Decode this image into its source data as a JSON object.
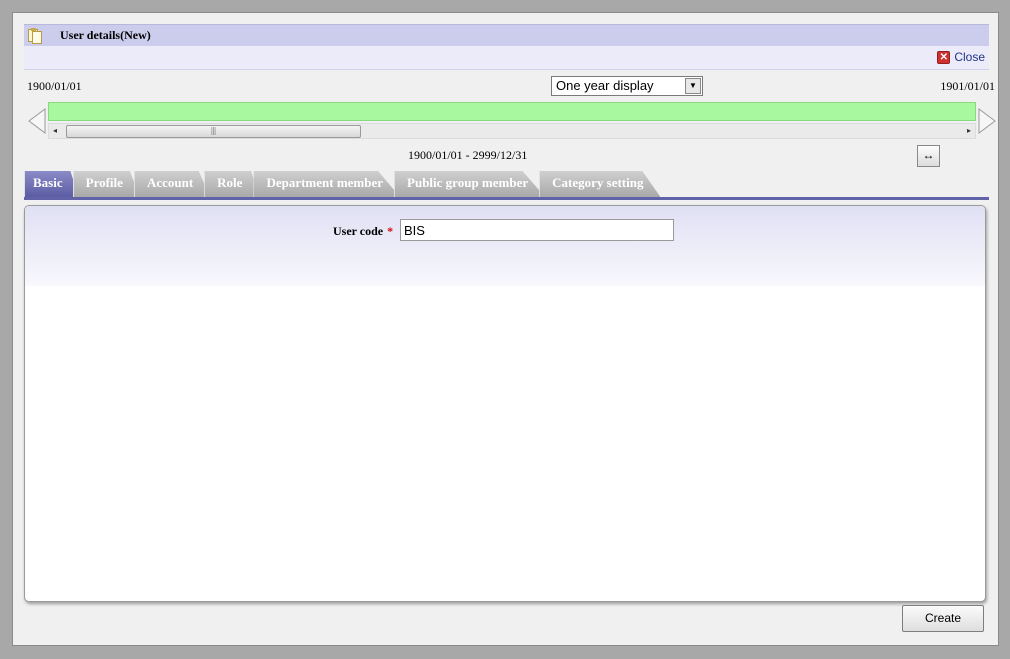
{
  "window": {
    "title": "User details(New)",
    "close_label": "Close"
  },
  "timeline": {
    "start_date": "1900/01/01",
    "end_date": "1901/01/01",
    "display_select": "One year display",
    "range_text": "1900/01/01 - 2999/12/31",
    "bar_color": "#a8f8a0"
  },
  "tabs": [
    {
      "label": "Basic",
      "active": true
    },
    {
      "label": "Profile"
    },
    {
      "label": "Account"
    },
    {
      "label": "Role"
    },
    {
      "label": "Department member"
    },
    {
      "label": "Public group member"
    },
    {
      "label": "Category setting"
    }
  ],
  "form": {
    "user_code_label": "User code",
    "required_mark": "*",
    "user_code_value": "BIS"
  },
  "actions": {
    "create_label": "Create"
  },
  "icons": {
    "title": "document-icon",
    "close": "close-icon",
    "prev": "chevron-left-icon",
    "next": "chevron-right-icon",
    "fit": "fit-width-icon"
  },
  "colors": {
    "accent": "#5c5ca4",
    "titlebar": "#ccccec",
    "required": "#d01010"
  }
}
